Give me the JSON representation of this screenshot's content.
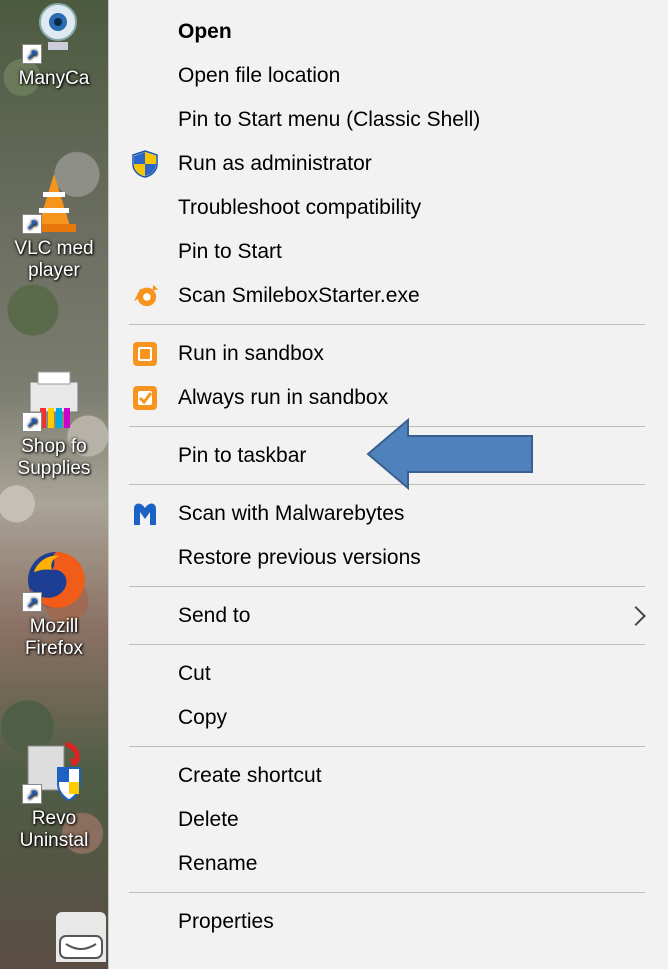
{
  "desktop": {
    "icons": [
      {
        "label": "ManyCa",
        "icon": "camera-icon"
      },
      {
        "label": "VLC med player",
        "line1": "VLC med",
        "line2": "player",
        "icon": "vlc-cone-icon"
      },
      {
        "label": "Shop fo Supplies",
        "line1": "Shop fo",
        "line2": "Supplies",
        "icon": "printer-icon"
      },
      {
        "label": "Mozilla Firefox",
        "line1": "Mozill",
        "line2": "Firefox",
        "icon": "firefox-icon"
      },
      {
        "label": "Revo Uninstal",
        "line1": "Revo",
        "line2": "Uninstal",
        "icon": "revo-uninstaller-icon"
      }
    ]
  },
  "menu": {
    "items": [
      {
        "label": "Open"
      },
      {
        "label": "Open file location"
      },
      {
        "label": "Pin to Start menu (Classic Shell)"
      },
      {
        "label": "Run as administrator",
        "icon": "uac-shield-icon"
      },
      {
        "label": "Troubleshoot compatibility"
      },
      {
        "label": "Pin to Start"
      },
      {
        "label": "Scan SmileboxStarter.exe",
        "icon": "avast-icon"
      },
      {
        "label": "Run in sandbox",
        "icon": "sandbox-icon"
      },
      {
        "label": "Always run in sandbox",
        "icon": "sandbox-check-icon"
      },
      {
        "label": "Pin to taskbar"
      },
      {
        "label": "Scan with Malwarebytes",
        "icon": "malwarebytes-icon"
      },
      {
        "label": "Restore previous versions"
      },
      {
        "label": "Send to",
        "submenu": true
      },
      {
        "label": "Cut"
      },
      {
        "label": "Copy"
      },
      {
        "label": "Create shortcut"
      },
      {
        "label": "Delete"
      },
      {
        "label": "Rename"
      },
      {
        "label": "Properties"
      }
    ]
  },
  "annotation": {
    "icon": "left-arrow-annotation",
    "color": "#4f81bd"
  },
  "colors": {
    "menu_bg": "#f2f2f2",
    "separator": "#bdbdbd",
    "accent_orange": "#f7941d",
    "malwarebytes_blue": "#1b62c4"
  }
}
